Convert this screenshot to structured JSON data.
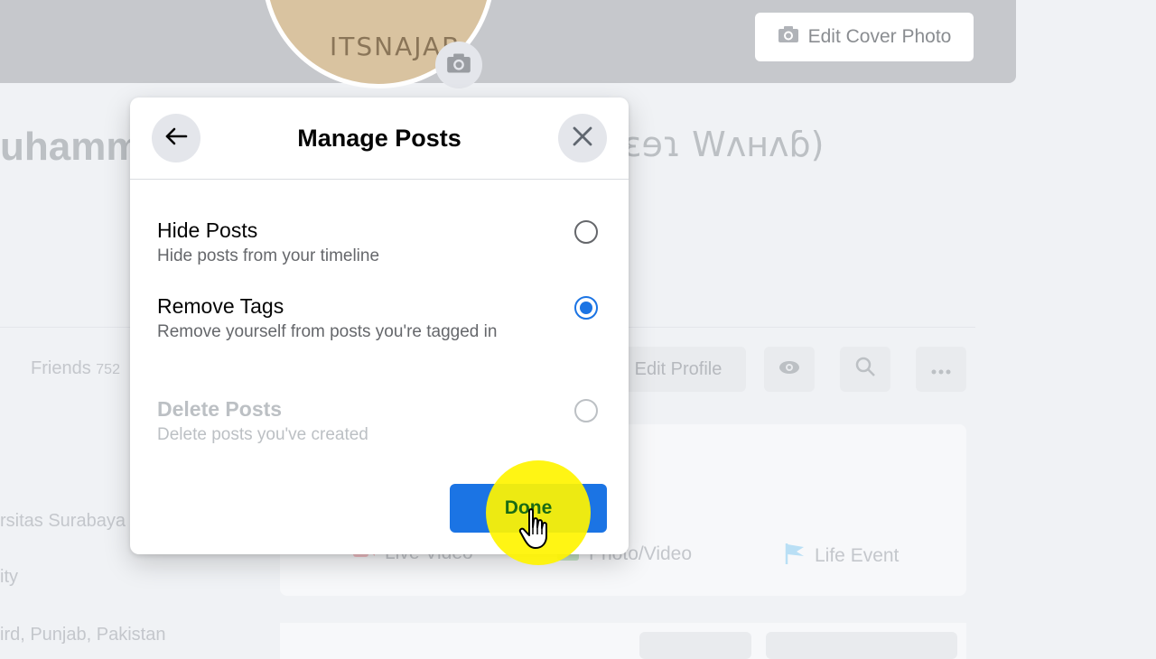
{
  "background": {
    "edit_cover_label": "Edit Cover Photo",
    "profile_watermark": "ITSNAJAB",
    "name_left": "uhamm",
    "name_right": "ɛɘɿ Wʌнʌɓ)",
    "friends_label": "Friends",
    "friends_count": "752",
    "edit_profile_label": "Edit Profile",
    "intro_lines": [
      "rsitas Surabaya",
      "ity",
      "ird, Punjab, Pakistan"
    ],
    "create_items": [
      "Live Video",
      "Photo/Video",
      "Life Event"
    ]
  },
  "modal": {
    "title": "Manage Posts",
    "options": [
      {
        "title": "Hide Posts",
        "desc": "Hide posts from your timeline",
        "selected": false,
        "disabled": false
      },
      {
        "title": "Remove Tags",
        "desc": "Remove yourself from posts you're tagged in",
        "selected": true,
        "disabled": false
      },
      {
        "title": "Delete Posts",
        "desc": "Delete posts you've created",
        "selected": false,
        "disabled": true
      }
    ],
    "done_label": "Done"
  },
  "colors": {
    "accent": "#1b74e4",
    "highlight": "#fff400",
    "done_text": "#1a6b14"
  },
  "icons": [
    "back-arrow-icon",
    "close-icon",
    "camera-icon",
    "eye-icon",
    "search-icon",
    "more-icon",
    "hand-cursor-icon",
    "flag-icon"
  ]
}
